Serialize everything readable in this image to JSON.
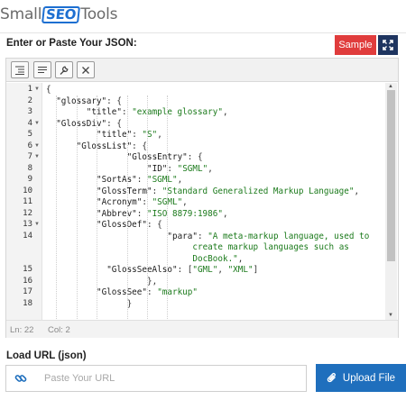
{
  "brand": {
    "part1": "Small",
    "part2": "SEO",
    "part3": "Tools"
  },
  "editor_section": {
    "title": "Enter or Paste Your JSON:",
    "sample_label": "Sample"
  },
  "toolbar": {
    "format_icon": "format-icon",
    "compact_icon": "compact-icon",
    "repair_icon": "wrench-icon",
    "clear_icon": "close-icon"
  },
  "code": {
    "line_numbers": [
      "1",
      "2",
      "3",
      "4",
      "5",
      "6",
      "7",
      "8",
      "9",
      "10",
      "11",
      "12",
      "13",
      "14",
      "",
      "",
      "15",
      "16",
      "17",
      "18"
    ],
    "lines": [
      [
        "{"
      ],
      [
        "\"glossary\"",
        ": {"
      ],
      [
        "\"title\"",
        ": ",
        "\"example glossary\"",
        ","
      ],
      [
        "\"GlossDiv\"",
        ": {"
      ],
      [
        "\"title\"",
        ": ",
        "\"S\"",
        ","
      ],
      [
        "\"GlossList\"",
        ": {"
      ],
      [
        "\"GlossEntry\"",
        ": {"
      ],
      [
        "\"ID\"",
        ": ",
        "\"SGML\"",
        ","
      ],
      [
        "\"SortAs\"",
        ": ",
        "\"SGML\"",
        ","
      ],
      [
        "\"GlossTerm\"",
        ": ",
        "\"Standard Generalized Markup Language\"",
        ","
      ],
      [
        "\"Acronym\"",
        ": ",
        "\"SGML\"",
        ","
      ],
      [
        "\"Abbrev\"",
        ": ",
        "\"ISO 8879:1986\"",
        ","
      ],
      [
        "\"GlossDef\"",
        ": {"
      ],
      [
        "\"para\"",
        ": ",
        "\"A meta-markup language, used to",
        ""
      ],
      [
        "create markup languages such as"
      ],
      [
        "DocBook.\"",
        ","
      ],
      [
        "\"GlossSeeAlso\"",
        ": [",
        "\"GML\"",
        ", ",
        "\"XML\"",
        "]"
      ],
      [
        "},"
      ],
      [
        "\"GlossSee\"",
        ": ",
        "\"markup\""
      ],
      [
        "}"
      ]
    ]
  },
  "status": {
    "line": "Ln: 22",
    "col": "Col: 2"
  },
  "url_section": {
    "title": "Load URL (json)",
    "placeholder": "Paste Your URL",
    "upload_label": "Upload File"
  }
}
